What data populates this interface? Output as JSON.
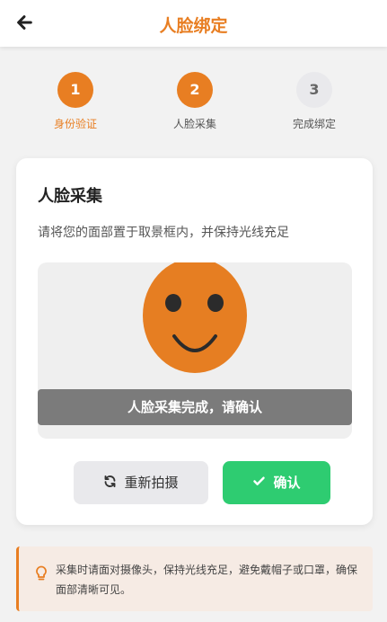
{
  "header": {
    "title": "人脸绑定",
    "back_icon": "arrow-left-icon"
  },
  "steps": [
    {
      "number": "1",
      "label": "身份验证",
      "state": "active"
    },
    {
      "number": "2",
      "label": "人脸采集",
      "state": "active"
    },
    {
      "number": "3",
      "label": "完成绑定",
      "state": "pending"
    }
  ],
  "card": {
    "title": "人脸采集",
    "description": "请将您的面部置于取景框内，并保持光线充足",
    "status": "人脸采集完成，请确认"
  },
  "actions": {
    "retake_label": "重新拍摄",
    "retake_icon": "refresh-icon",
    "confirm_label": "确认",
    "confirm_icon": "check-icon"
  },
  "tip": {
    "icon": "lightbulb-icon",
    "text": "采集时请面对摄像头，保持光线充足，避免戴帽子或口罩，确保面部清晰可见。"
  },
  "colors": {
    "accent": "#e87e22",
    "success": "#2ecc71",
    "face": "#e67e22"
  }
}
